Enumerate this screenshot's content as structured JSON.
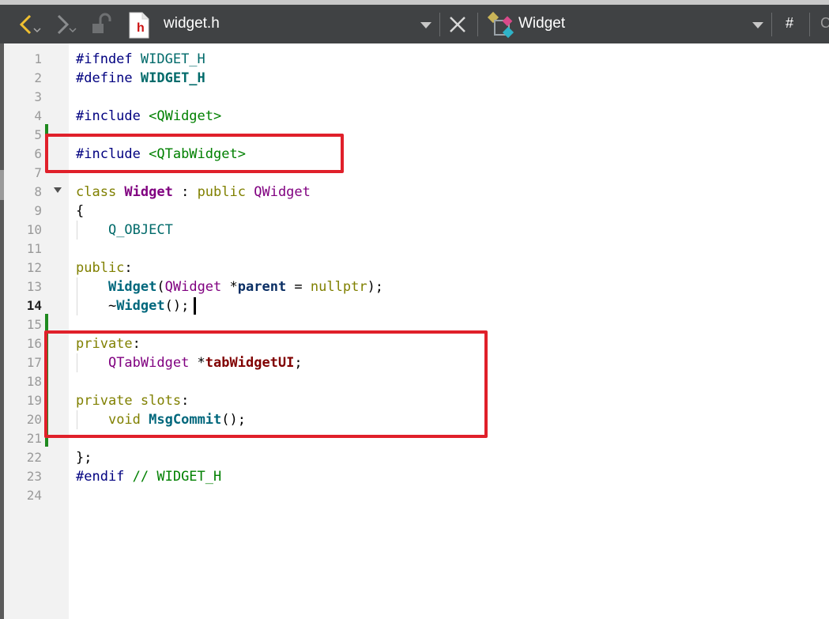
{
  "toolbar": {
    "file_name": "widget.h",
    "file_icon_letter": "h",
    "symbol_name": "Widget",
    "hash_label": "#",
    "trailing_label": "C"
  },
  "editor": {
    "current_line": 14,
    "line_numbers": [
      "1",
      "2",
      "3",
      "4",
      "5",
      "6",
      "7",
      "8",
      "9",
      "10",
      "11",
      "12",
      "13",
      "14",
      "15",
      "16",
      "17",
      "18",
      "19",
      "20",
      "21",
      "22",
      "23",
      "24"
    ],
    "lines": {
      "l1": {
        "a": "#ifndef ",
        "b": "WIDGET_H"
      },
      "l2": {
        "a": "#define ",
        "b": "WIDGET_H"
      },
      "l4": {
        "a": "#include ",
        "b": "<QWidget>"
      },
      "l6": {
        "a": "#include ",
        "b": "<QTabWidget>"
      },
      "l8": {
        "a": "class ",
        "b": "Widget",
        "c": " : ",
        "d": "public",
        "e": " ",
        "f": "QWidget"
      },
      "l9": {
        "a": "{"
      },
      "l10": {
        "a": "    ",
        "b": "Q_OBJECT"
      },
      "l12": {
        "a": "public",
        "b": ":"
      },
      "l13": {
        "a": "    ",
        "b": "Widget",
        "c": "(",
        "d": "QWidget",
        "e": " *",
        "f": "parent",
        "g": " = ",
        "h": "nullptr",
        "i": ");"
      },
      "l14": {
        "a": "    ~",
        "b": "Widget",
        "c": "();"
      },
      "l16": {
        "a": "private",
        "b": ":"
      },
      "l17": {
        "a": "    ",
        "b": "QTabWidget",
        "c": " *",
        "d": "tabWidgetUI",
        "e": ";"
      },
      "l19": {
        "a": "private slots",
        "b": ":"
      },
      "l20": {
        "a": "    ",
        "b": "void",
        "c": " ",
        "d": "MsgCommit",
        "e": "();"
      },
      "l22": {
        "a": "};"
      },
      "l23": {
        "a": "#endif ",
        "b": "// WIDGET_H"
      }
    }
  },
  "colors": {
    "toolbar_bg": "#404244",
    "gutter_bg": "#f2f2f2",
    "highlight_box": "#e0202a",
    "modified_marker": "#1f8a1f"
  },
  "icons": [
    "back-arrow-icon",
    "forward-arrow-icon",
    "unlock-icon",
    "header-file-icon",
    "dropdown-icon",
    "close-icon",
    "class-icon",
    "fold-arrow-icon"
  ]
}
